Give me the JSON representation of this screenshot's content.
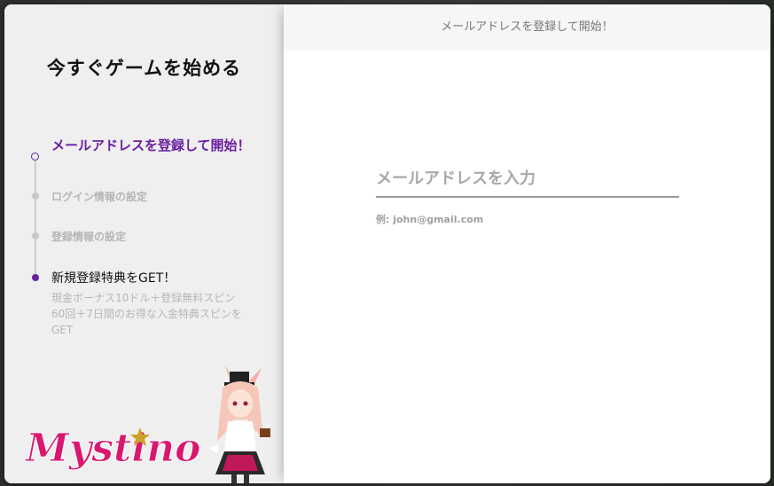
{
  "left_panel": {
    "title": "今すぐゲームを始める",
    "steps": [
      {
        "label": "メールアドレスを登録して開始！",
        "state": "current"
      },
      {
        "label": "ログイン情報の設定",
        "state": "upcoming"
      },
      {
        "label": "登録情報の設定",
        "state": "upcoming"
      },
      {
        "label": "新規登録特典をGET！",
        "state": "final",
        "description": "現金ボーナス10ドル＋登録無料スピン60回＋7日間のお得な入金特典スピンをGET"
      }
    ],
    "logo_text": "Mystino",
    "colors": {
      "accent": "#6a1fa0",
      "logo": "#d9176f",
      "star": "#c9a227"
    }
  },
  "right_panel": {
    "header": "メールアドレスを登録して開始！",
    "email_field": {
      "placeholder": "メールアドレスを入力",
      "value": ""
    },
    "example": "例: john@gmail.com"
  }
}
